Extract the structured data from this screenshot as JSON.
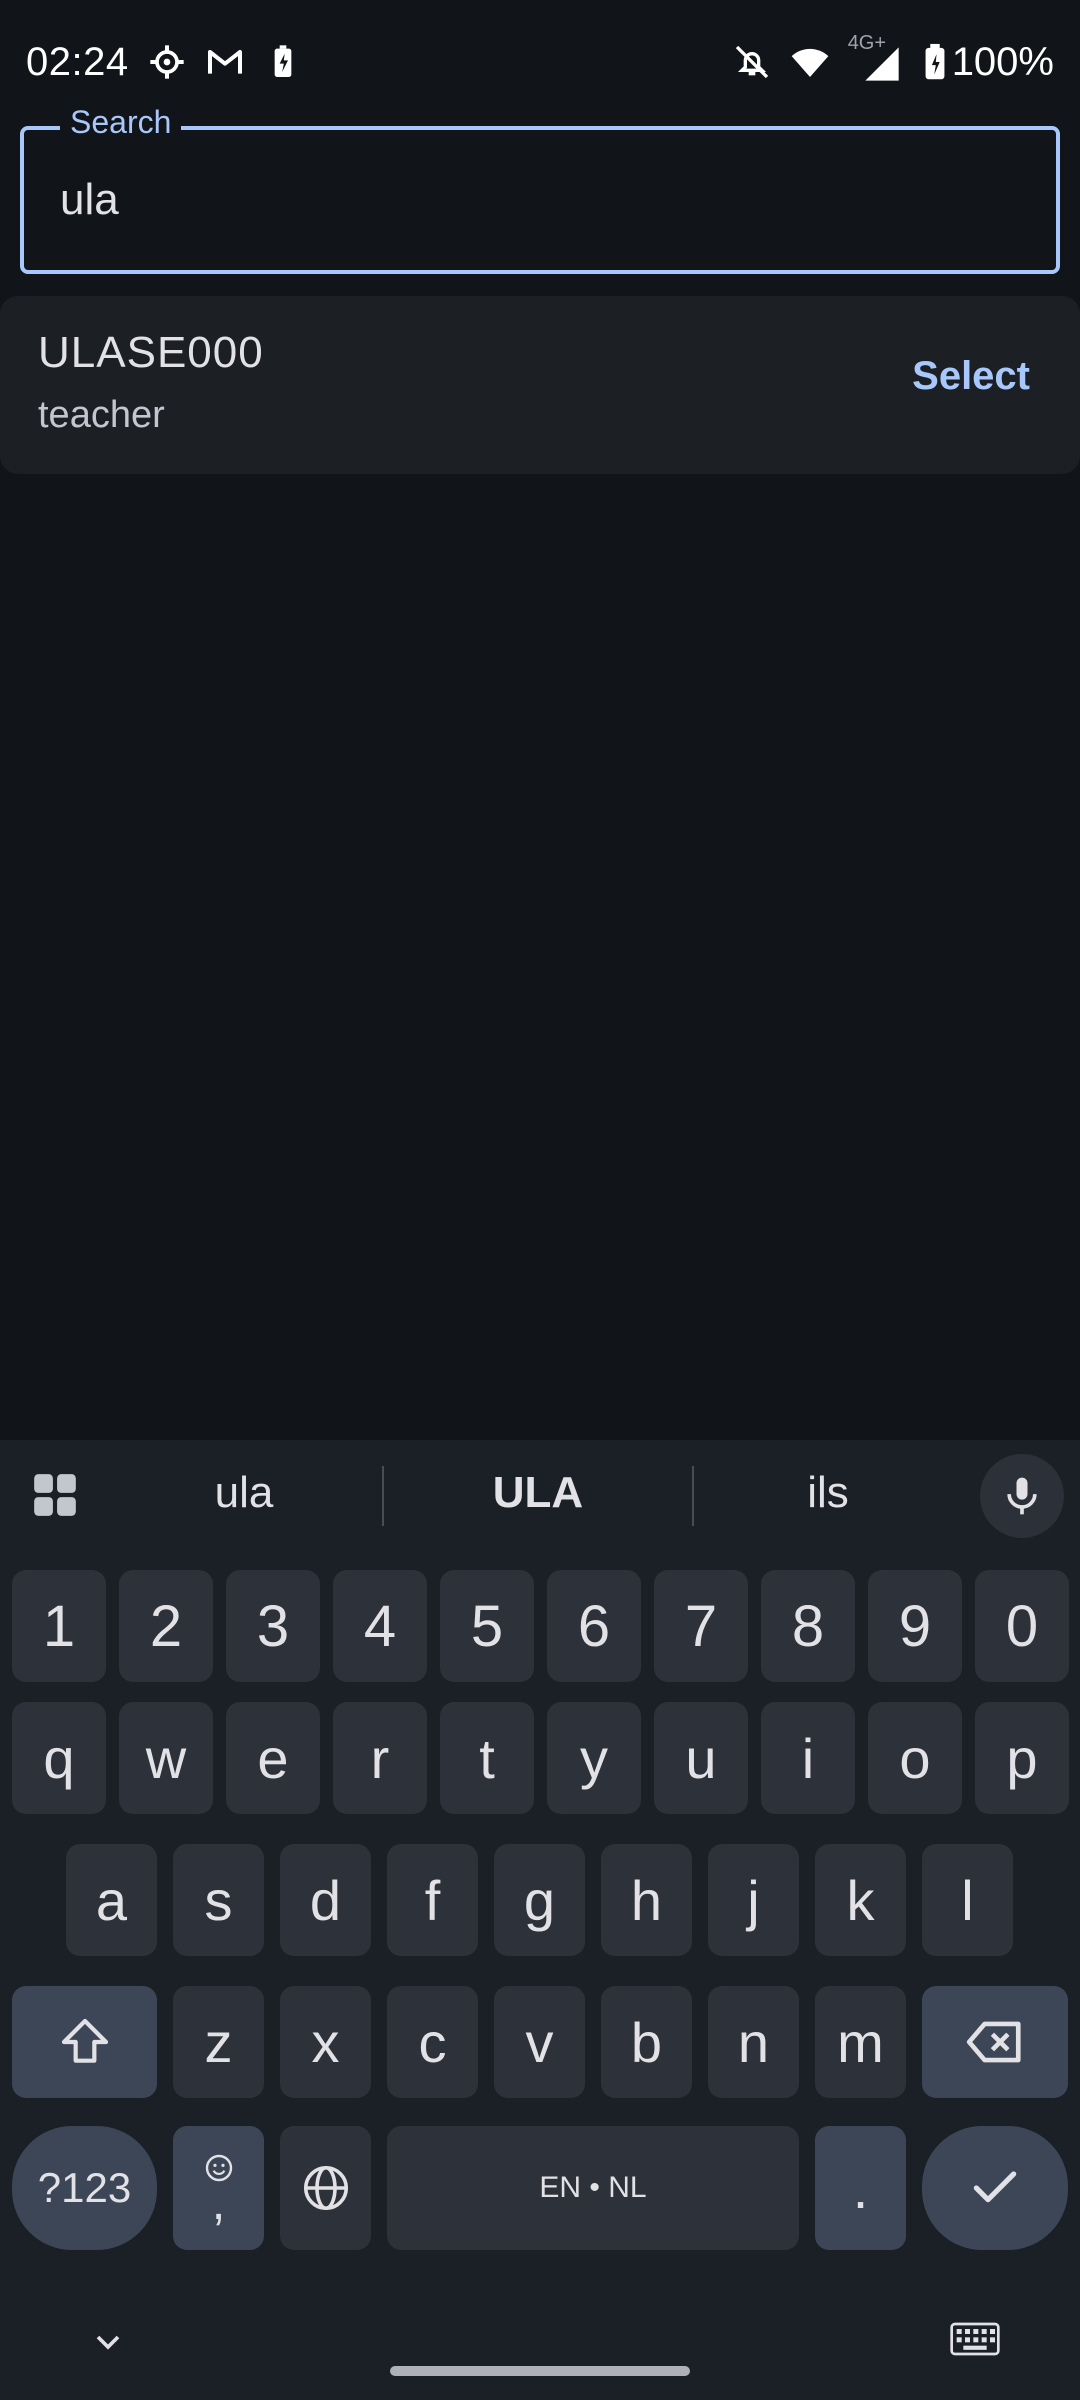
{
  "status_bar": {
    "time": "02:24",
    "left_icons": [
      "settings-icon",
      "gmail-icon",
      "battery-saver-icon"
    ],
    "right_icons": [
      "notifications-off-icon",
      "wifi-icon",
      "signal-icon"
    ],
    "network_type": "4G+",
    "battery": "100%"
  },
  "search": {
    "label": "Search",
    "value": "ula",
    "accent_color": "#a8c7fa"
  },
  "results": [
    {
      "title": "ULASE000",
      "subtitle": "teacher",
      "action": "Select"
    }
  ],
  "keyboard": {
    "suggestions": [
      "ula",
      "ULA",
      "ils"
    ],
    "row_numbers": [
      "1",
      "2",
      "3",
      "4",
      "5",
      "6",
      "7",
      "8",
      "9",
      "0"
    ],
    "row_1": [
      "q",
      "w",
      "e",
      "r",
      "t",
      "y",
      "u",
      "i",
      "o",
      "p"
    ],
    "row_2": [
      "a",
      "s",
      "d",
      "f",
      "g",
      "h",
      "j",
      "k",
      "l"
    ],
    "row_3": [
      "z",
      "x",
      "c",
      "v",
      "b",
      "n",
      "m"
    ],
    "symbols_key": "?123",
    "comma_key": ",",
    "space_label": "EN • NL",
    "period_key": "."
  }
}
